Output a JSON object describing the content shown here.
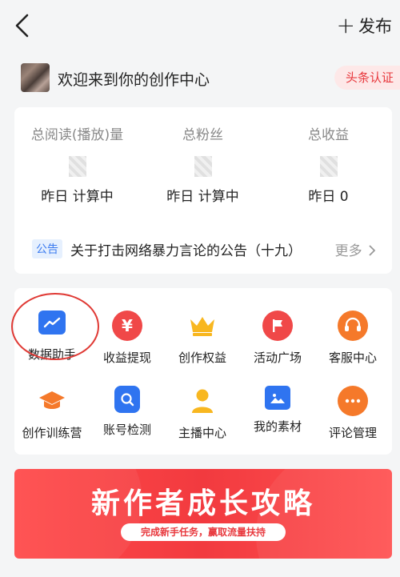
{
  "header": {
    "publish_label": "发布"
  },
  "welcome": {
    "text": "欢迎来到你的创作中心",
    "verify_label": "头条认证"
  },
  "stats": [
    {
      "label": "总阅读(播放)量",
      "sub": "昨日 计算中"
    },
    {
      "label": "总粉丝",
      "sub": "昨日 计算中"
    },
    {
      "label": "总收益",
      "sub": "昨日 0"
    }
  ],
  "notice": {
    "tag": "公告",
    "text": "关于打击网络暴力言论的公告（十九）",
    "more": "更多"
  },
  "tools": [
    {
      "label": "数据助手",
      "icon": "data-chart-icon"
    },
    {
      "label": "收益提现",
      "icon": "yuan-icon"
    },
    {
      "label": "创作权益",
      "icon": "crown-icon"
    },
    {
      "label": "活动广场",
      "icon": "flag-icon"
    },
    {
      "label": "客服中心",
      "icon": "headset-icon"
    },
    {
      "label": "创作训练营",
      "icon": "graduation-cap-icon"
    },
    {
      "label": "账号检测",
      "icon": "shield-search-icon"
    },
    {
      "label": "主播中心",
      "icon": "person-icon"
    },
    {
      "label": "我的素材",
      "icon": "image-icon"
    },
    {
      "label": "评论管理",
      "icon": "comment-icon"
    }
  ],
  "banner": {
    "title": "新作者成长攻略",
    "subtitle": "完成新手任务，赢取流量扶持"
  },
  "colors": {
    "accent_red": "#e8383d",
    "notice_blue": "#3d7cf0",
    "background": "#f4f5f6"
  }
}
